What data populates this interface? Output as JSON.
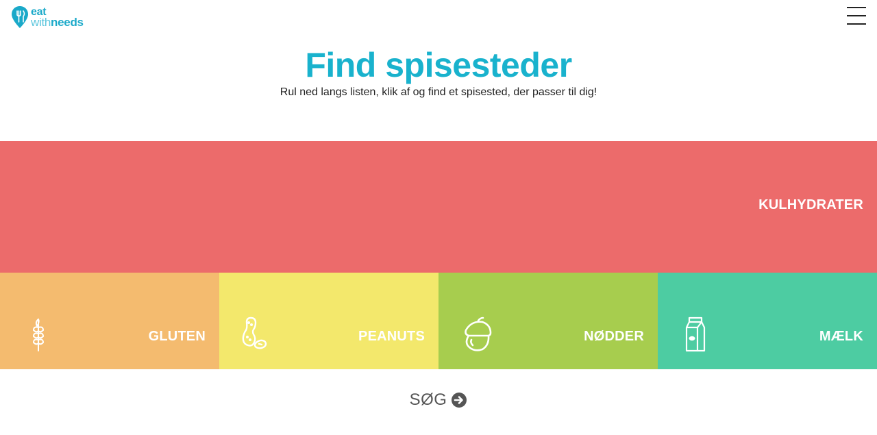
{
  "brand": {
    "line1": "eat",
    "line2_a": "with",
    "line2_b": "needs"
  },
  "menu": {
    "icon": "hamburger-menu-icon"
  },
  "hero": {
    "title": "Find spisesteder",
    "subtitle": "Rul ned langs listen, klik af og find et spisested, der passer til dig!"
  },
  "categories": [
    {
      "label": "KULHYDRATER",
      "color": "#ec6b6b",
      "icon": ""
    },
    {
      "label": "GLUTEN",
      "color": "#f4bb6f",
      "icon": "wheat-icon"
    },
    {
      "label": "PEANUTS",
      "color": "#f3e86c",
      "icon": "peanut-icon"
    },
    {
      "label": "NØDDER",
      "color": "#a7cd4e",
      "icon": "acorn-icon"
    },
    {
      "label": "MÆLK",
      "color": "#4dcca2",
      "icon": "milk-carton-icon"
    }
  ],
  "search": {
    "label": "SØG",
    "icon": "arrow-right-circle-icon"
  },
  "colors": {
    "accent": "#19b2cd",
    "text": "#222222",
    "search_text": "#555555"
  }
}
